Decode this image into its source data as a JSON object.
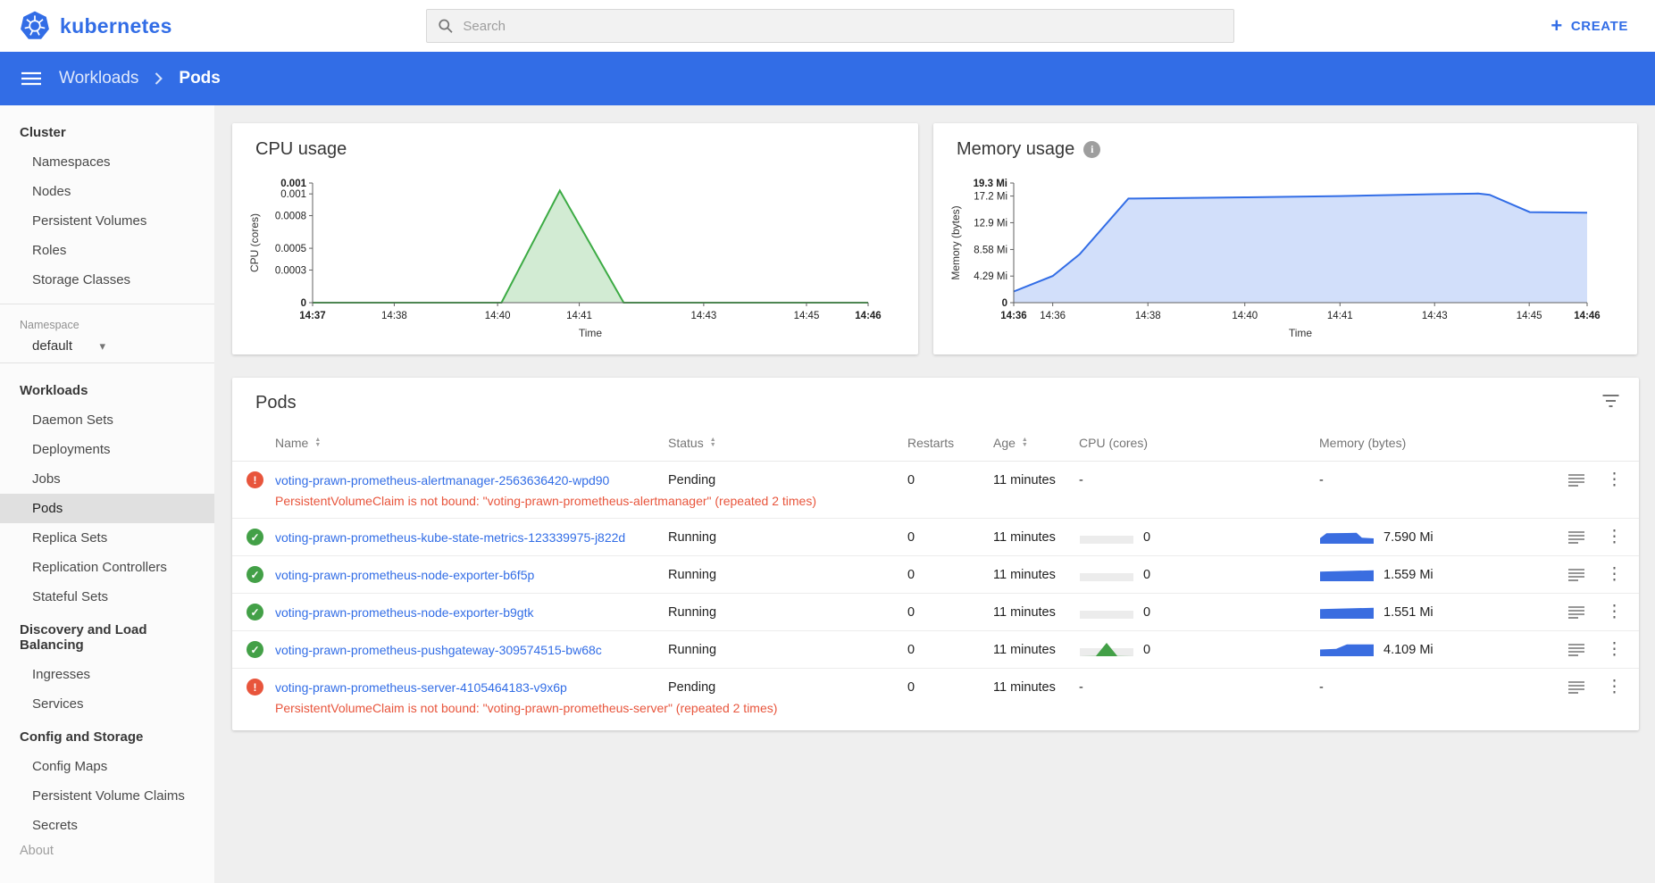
{
  "topbar": {
    "brand": "kubernetes",
    "search_placeholder": "Search",
    "create_label": "CREATE"
  },
  "toolbar": {
    "breadcrumb_parent": "Workloads",
    "breadcrumb_current": "Pods"
  },
  "sidebar": {
    "sections": [
      {
        "header": "Cluster",
        "items": [
          "Namespaces",
          "Nodes",
          "Persistent Volumes",
          "Roles",
          "Storage Classes"
        ]
      },
      {
        "header": "Workloads",
        "items": [
          "Daemon Sets",
          "Deployments",
          "Jobs",
          "Pods",
          "Replica Sets",
          "Replication Controllers",
          "Stateful Sets"
        ]
      },
      {
        "header": "Discovery and Load Balancing",
        "items": [
          "Ingresses",
          "Services"
        ]
      },
      {
        "header": "Config and Storage",
        "items": [
          "Config Maps",
          "Persistent Volume Claims",
          "Secrets"
        ]
      }
    ],
    "selected_item": "Pods",
    "namespace_label": "Namespace",
    "namespace_value": "default",
    "about_label": "About"
  },
  "chart_data": [
    {
      "type": "area",
      "title": "CPU usage",
      "xlabel": "Time",
      "ylabel": "CPU (cores)",
      "ylim": [
        0,
        0.0011
      ],
      "grid": false,
      "color": "#3cab44",
      "fill": "rgba(76,175,80,0.25)",
      "x_ticks": [
        {
          "pos": 0,
          "label": "14:37",
          "bold": true
        },
        {
          "pos": 0.147,
          "label": "14:38"
        },
        {
          "pos": 0.333,
          "label": "14:40"
        },
        {
          "pos": 0.48,
          "label": "14:41"
        },
        {
          "pos": 0.704,
          "label": "14:43"
        },
        {
          "pos": 0.889,
          "label": "14:45"
        },
        {
          "pos": 1,
          "label": "14:46",
          "bold": true
        }
      ],
      "y_ticks": [
        {
          "value": 0.0011,
          "label": "0.001",
          "bold": true
        },
        {
          "value": 0.001,
          "label": "0.001"
        },
        {
          "value": 0.0008,
          "label": "0.0008"
        },
        {
          "value": 0.0005,
          "label": "0.0005"
        },
        {
          "value": 0.0003,
          "label": "0.0003"
        },
        {
          "value": 0,
          "label": "0",
          "bold": true
        }
      ],
      "points": [
        [
          0,
          0
        ],
        [
          0.34,
          0
        ],
        [
          0.445,
          0.00103
        ],
        [
          0.56,
          0
        ],
        [
          1,
          0
        ]
      ]
    },
    {
      "type": "area",
      "title": "Memory usage",
      "xlabel": "Time",
      "ylabel": "Memory (bytes)",
      "unit": "Mi",
      "ylim": [
        0,
        19.3
      ],
      "grid": false,
      "color": "#326de6",
      "fill": "rgba(50,109,230,0.22)",
      "x_ticks": [
        {
          "pos": 0,
          "label": "14:36",
          "bold": true
        },
        {
          "pos": 0.068,
          "label": "14:36"
        },
        {
          "pos": 0.234,
          "label": "14:38"
        },
        {
          "pos": 0.403,
          "label": "14:40"
        },
        {
          "pos": 0.569,
          "label": "14:41"
        },
        {
          "pos": 0.734,
          "label": "14:43"
        },
        {
          "pos": 0.899,
          "label": "14:45"
        },
        {
          "pos": 1,
          "label": "14:46",
          "bold": true
        }
      ],
      "y_ticks": [
        {
          "value": 19.3,
          "label": "19.3 Mi",
          "bold": true
        },
        {
          "value": 17.2,
          "label": "17.2 Mi"
        },
        {
          "value": 12.9,
          "label": "12.9 Mi"
        },
        {
          "value": 8.58,
          "label": "8.58 Mi"
        },
        {
          "value": 4.29,
          "label": "4.29 Mi"
        },
        {
          "value": 0,
          "label": "0",
          "bold": true
        }
      ],
      "points": [
        [
          0,
          1.8
        ],
        [
          0.068,
          4.3
        ],
        [
          0.115,
          7.8
        ],
        [
          0.2,
          16.8
        ],
        [
          0.403,
          17.0
        ],
        [
          0.569,
          17.2
        ],
        [
          0.734,
          17.5
        ],
        [
          0.81,
          17.6
        ],
        [
          0.83,
          17.4
        ],
        [
          0.9,
          14.6
        ],
        [
          1,
          14.5
        ]
      ]
    }
  ],
  "pods": {
    "title": "Pods",
    "columns": {
      "name": "Name",
      "status": "Status",
      "restarts": "Restarts",
      "age": "Age",
      "cpu": "CPU (cores)",
      "memory": "Memory (bytes)"
    },
    "rows": [
      {
        "status": "error",
        "name": "voting-prawn-prometheus-alertmanager-2563636420-wpd90",
        "status_text": "Pending",
        "restarts": "0",
        "age": "11 minutes",
        "cpu": {
          "text": "-"
        },
        "mem": {
          "text": "-"
        },
        "warning": "PersistentVolumeClaim is not bound: \"voting-prawn-prometheus-alertmanager\" (repeated 2 times)"
      },
      {
        "status": "ok",
        "name": "voting-prawn-prometheus-kube-state-metrics-123339975-j822d",
        "status_text": "Running",
        "restarts": "0",
        "age": "11 minutes",
        "cpu": {
          "text": "0",
          "spark": [
            [
              0,
              0.6
            ],
            [
              1,
              0.6
            ]
          ],
          "color": "#ececec"
        },
        "mem": {
          "text": "7.590 Mi",
          "spark": [
            [
              0,
              0.42
            ],
            [
              0.12,
              0.78
            ],
            [
              0.5,
              0.8
            ],
            [
              0.68,
              0.82
            ],
            [
              0.78,
              0.45
            ],
            [
              1,
              0.4
            ]
          ],
          "color": "#3a6de0"
        }
      },
      {
        "status": "ok",
        "name": "voting-prawn-prometheus-node-exporter-b6f5p",
        "status_text": "Running",
        "restarts": "0",
        "age": "11 minutes",
        "cpu": {
          "text": "0",
          "spark": [
            [
              0,
              0.6
            ],
            [
              1,
              0.6
            ]
          ],
          "color": "#ececec"
        },
        "mem": {
          "text": "1.559 Mi",
          "spark": [
            [
              0,
              0.72
            ],
            [
              1,
              0.82
            ]
          ],
          "color": "#3a6de0"
        }
      },
      {
        "status": "ok",
        "name": "voting-prawn-prometheus-node-exporter-b9gtk",
        "status_text": "Running",
        "restarts": "0",
        "age": "11 minutes",
        "cpu": {
          "text": "0",
          "spark": [
            [
              0,
              0.6
            ],
            [
              1,
              0.6
            ]
          ],
          "color": "#ececec"
        },
        "mem": {
          "text": "1.551 Mi",
          "spark": [
            [
              0,
              0.72
            ],
            [
              1,
              0.82
            ]
          ],
          "color": "#3a6de0"
        }
      },
      {
        "status": "ok",
        "name": "voting-prawn-prometheus-pushgateway-309574515-bw68c",
        "status_text": "Running",
        "restarts": "0",
        "age": "11 minutes",
        "cpu": {
          "text": "0",
          "spark": [
            [
              0,
              0.6
            ],
            [
              1,
              0.6
            ]
          ],
          "color": "#ececec",
          "overlay": [
            [
              0.3,
              0.02
            ],
            [
              0.5,
              1
            ],
            [
              0.7,
              0.02
            ]
          ],
          "overlay_color": "#43a047"
        },
        "mem": {
          "text": "4.109 Mi",
          "spark": [
            [
              0,
              0.5
            ],
            [
              0.3,
              0.55
            ],
            [
              0.5,
              0.88
            ],
            [
              1,
              0.88
            ]
          ],
          "color": "#3a6de0"
        }
      },
      {
        "status": "error",
        "name": "voting-prawn-prometheus-server-4105464183-v9x6p",
        "status_text": "Pending",
        "restarts": "0",
        "age": "11 minutes",
        "cpu": {
          "text": "-"
        },
        "mem": {
          "text": "-"
        },
        "warning": "PersistentVolumeClaim is not bound: \"voting-prawn-prometheus-server\" (repeated 2 times)"
      }
    ]
  },
  "colors": {
    "brand_blue": "#326de6",
    "success_green": "#43a047",
    "error_red": "#e8553c"
  }
}
